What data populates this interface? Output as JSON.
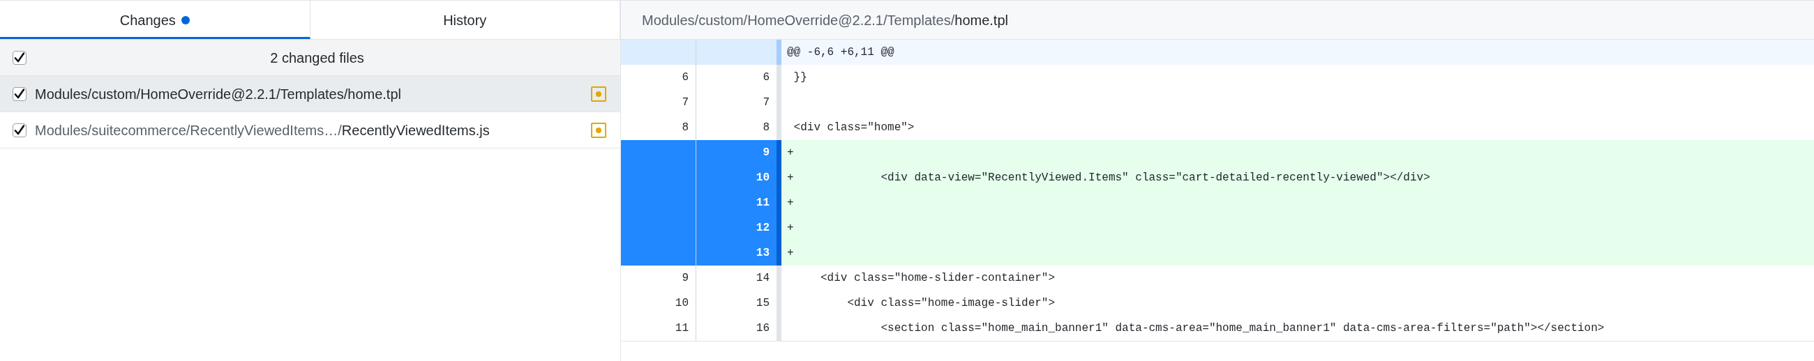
{
  "tabs": [
    {
      "label": "Changes",
      "selected": true,
      "indicator": true
    },
    {
      "label": "History",
      "selected": false,
      "indicator": false
    }
  ],
  "changes": {
    "header": {
      "label": "2 changed files",
      "checked": true
    },
    "files": [
      {
        "directory": "Modules/custom/HomeOverride@2.2.1/Templates/",
        "filename": "home.tpl",
        "checked": true,
        "selected": true
      },
      {
        "directory": "Modules/suitecommerce/RecentlyViewedItems…/",
        "filename": "RecentlyViewedItems.js",
        "checked": true,
        "selected": false
      }
    ]
  },
  "diff": {
    "path": {
      "directory": "Modules/custom/HomeOverride@2.2.1/Templates/",
      "filename": "home.tpl"
    },
    "lines": [
      {
        "kind": "hunk",
        "content": "@@ -6,6 +6,11 @@"
      },
      {
        "kind": "context",
        "old": "6",
        "new": "6",
        "content": " }}"
      },
      {
        "kind": "context",
        "old": "7",
        "new": "7"
      },
      {
        "kind": "context",
        "old": "8",
        "new": "8",
        "content": " <div class=\"home\">"
      },
      {
        "kind": "added",
        "new": "9",
        "content": "+",
        "selected": true
      },
      {
        "kind": "added",
        "new": "10",
        "content": "+             <div data-view=\"RecentlyViewed.Items\" class=\"cart-detailed-recently-viewed\"></div>",
        "selected": true
      },
      {
        "kind": "added",
        "new": "11",
        "content": "+",
        "selected": true
      },
      {
        "kind": "added",
        "new": "12",
        "content": "+",
        "selected": true
      },
      {
        "kind": "added",
        "new": "13",
        "content": "+",
        "selected": true
      },
      {
        "kind": "context",
        "old": "9",
        "new": "14",
        "content": "     <div class=\"home-slider-container\">"
      },
      {
        "kind": "context",
        "old": "10",
        "new": "15",
        "content": "         <div class=\"home-image-slider\">"
      },
      {
        "kind": "context",
        "old": "11",
        "new": "16",
        "content": "              <section class=\"home_main_banner1\" data-cms-area=\"home_main_banner1\" data-cms-area-filters=\"path\"></section>"
      }
    ]
  }
}
